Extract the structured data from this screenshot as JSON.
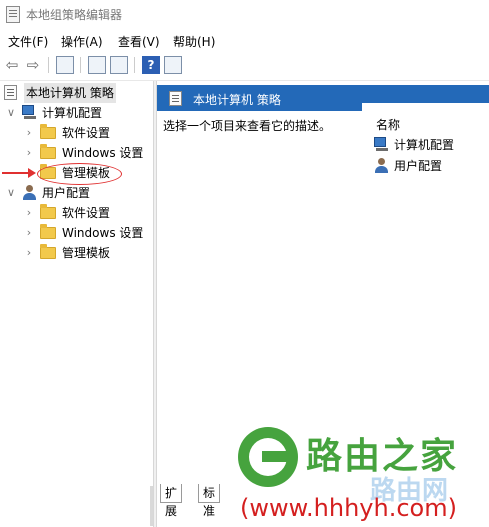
{
  "window": {
    "title": "本地组策略编辑器"
  },
  "menu": {
    "items": [
      "文件(F)",
      "操作(A)",
      "查看(V)",
      "帮助(H)"
    ]
  },
  "toolbar": {
    "help_glyph": "?"
  },
  "tree": {
    "root": "本地计算机 策略",
    "computer_config": "计算机配置",
    "computer_children": [
      "软件设置",
      "Windows 设置",
      "管理模板"
    ],
    "user_config": "用户配置",
    "user_children": [
      "软件设置",
      "Windows 设置",
      "管理模板"
    ]
  },
  "content": {
    "header": "本地计算机 策略",
    "description": "选择一个项目来查看它的描述。",
    "name_column": "名称",
    "items": [
      "计算机配置",
      "用户配置"
    ]
  },
  "tabs": [
    "扩展",
    "标准"
  ],
  "watermark": {
    "brand": "路由之家",
    "url": "(www.hhhyh.com)",
    "ghost": "路由网"
  },
  "colors": {
    "header_bg": "#2369b8",
    "annotation": "#e03030",
    "watermark_green": "#46a33e",
    "watermark_red": "#d41f1f"
  }
}
